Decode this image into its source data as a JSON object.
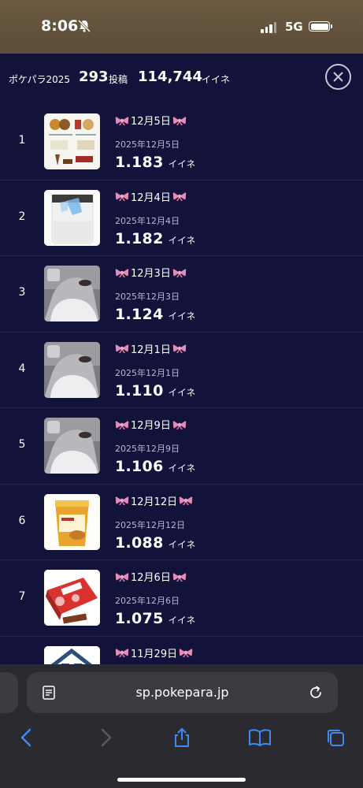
{
  "status_bar": {
    "time": "8:06",
    "network": "5G"
  },
  "header": {
    "brand": "ポケパラ2025",
    "posts_count": "293",
    "posts_label": "投稿",
    "likes_count": "114,744",
    "likes_label": "イイネ"
  },
  "posts": [
    {
      "rank": "1",
      "title": "12月5日",
      "date": "2025年12月5日",
      "likes": "1.183",
      "likes_unit": "イイネ",
      "thumb": "snack-flyer"
    },
    {
      "rank": "2",
      "title": "12月4日",
      "date": "2025年12月4日",
      "likes": "1.182",
      "likes_unit": "イイネ",
      "thumb": "air-purifier"
    },
    {
      "rank": "3",
      "title": "12月3日",
      "date": "2025年12月3日",
      "likes": "1.124",
      "likes_unit": "イイネ",
      "thumb": "masked-selfie"
    },
    {
      "rank": "4",
      "title": "12月1日",
      "date": "2025年12月1日",
      "likes": "1.110",
      "likes_unit": "イイネ",
      "thumb": "masked-selfie"
    },
    {
      "rank": "5",
      "title": "12月9日",
      "date": "2025年12月9日",
      "likes": "1.106",
      "likes_unit": "イイネ",
      "thumb": "masked-selfie"
    },
    {
      "rank": "6",
      "title": "12月12日",
      "date": "2025年12月12日",
      "likes": "1.088",
      "likes_unit": "イイネ",
      "thumb": "dessert-cup"
    },
    {
      "rank": "7",
      "title": "12月6日",
      "date": "2025年12月6日",
      "likes": "1.075",
      "likes_unit": "イイネ",
      "thumb": "strawberry-box"
    },
    {
      "rank": "",
      "title": "11月29日",
      "date": "",
      "likes": "",
      "likes_unit": "",
      "thumb": "house"
    }
  ],
  "browser": {
    "url": "sp.pokepara.jp"
  },
  "colors": {
    "page_bg": "#13123a",
    "ribbon": "#e68bb8",
    "toolbar_accent": "#3d8bf0"
  }
}
